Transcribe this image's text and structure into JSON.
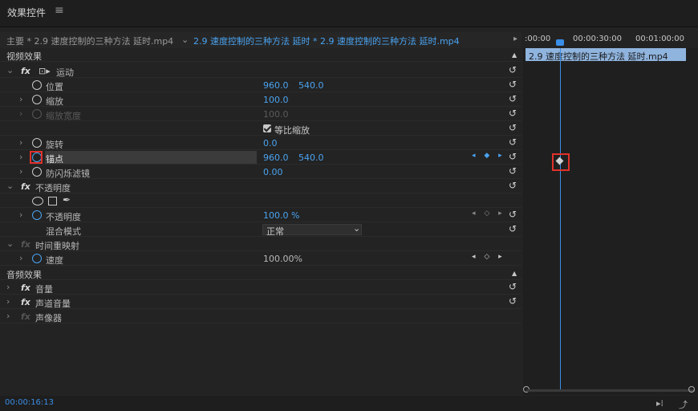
{
  "panel": {
    "title": "效果控件",
    "menu_glyph": "≡"
  },
  "clip_selector": {
    "master": "主要 * 2.9 速度控制的三种方法 延时.mp4",
    "dropdown_glyph": "⌄",
    "sequence": "2.9 速度控制的三种方法 延时 * 2.9 速度控制的三种方法 延时.mp4"
  },
  "sections": {
    "video": "视频效果",
    "audio": "音频效果"
  },
  "motion": {
    "label": "运动",
    "position": {
      "label": "位置",
      "x": "960.0",
      "y": "540.0"
    },
    "scale": {
      "label": "缩放",
      "value": "100.0"
    },
    "scale_width": {
      "label": "缩放宽度",
      "value": "100.0"
    },
    "uniform": {
      "label": "等比缩放"
    },
    "rotation": {
      "label": "旋转",
      "value": "0.0"
    },
    "anchor": {
      "label": "锚点",
      "x": "960.0",
      "y": "540.0"
    },
    "antiflicker": {
      "label": "防闪烁滤镜",
      "value": "0.00"
    }
  },
  "opacity": {
    "label": "不透明度",
    "value_label": "不透明度",
    "value": "100.0 %",
    "blend_label": "混合模式",
    "blend_value": "正常"
  },
  "timeremap": {
    "label": "时间重映射",
    "speed_label": "速度",
    "speed_value": "100.00%"
  },
  "audio": {
    "volume": "音量",
    "channel_volume": "声道音量",
    "panner": "声像器"
  },
  "glyphs": {
    "reset": "↺",
    "chev_right": "›",
    "chev_down": "⌄",
    "fx": "fx",
    "collapse": "▲",
    "play": "▸",
    "nav": "◂ ◇ ▸",
    "nav_on": "◂ ◆ ▸"
  },
  "timeline": {
    "ruler_start": ":00:00",
    "ruler_mid": "00:00:30:00",
    "ruler_end": "00:01:00:00",
    "clip": "2.9 速度控制的三种方法 延时.mp4"
  },
  "footer": {
    "timecode": "00:00:16:13"
  }
}
